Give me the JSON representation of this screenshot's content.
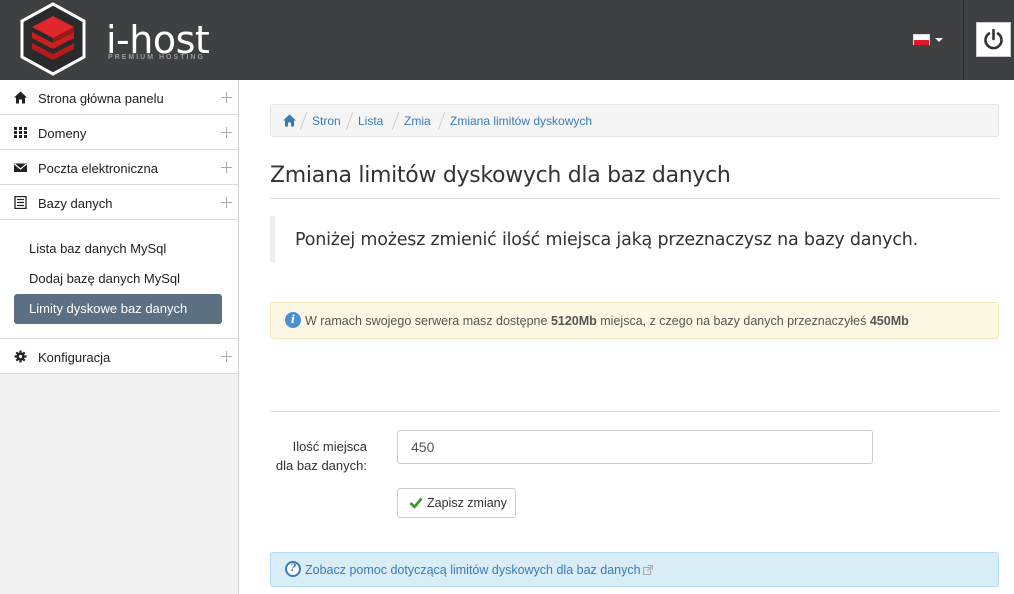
{
  "header": {
    "logo_text": "i-host",
    "logo_subtitle": "PREMIUM HOSTING",
    "language": "pl"
  },
  "sidebar": {
    "items": [
      {
        "label": "Strona główna panelu",
        "icon": "home-icon"
      },
      {
        "label": "Domeny",
        "icon": "grid-icon"
      },
      {
        "label": "Poczta elektroniczna",
        "icon": "envelope-icon"
      },
      {
        "label": "Bazy danych",
        "icon": "list-icon"
      },
      {
        "label": "Konfiguracja",
        "icon": "gear-icon"
      }
    ],
    "submenu": [
      {
        "label": "Lista baz danych MySql",
        "active": false
      },
      {
        "label": "Dodaj bazę danych MySql",
        "active": false
      },
      {
        "label": "Limity dyskowe baz danych",
        "active": true
      }
    ]
  },
  "breadcrumb": [
    "Stron",
    "Lista",
    "Zmia",
    "Zmiana limitów dyskowych"
  ],
  "page": {
    "title": "Zmiana limitów dyskowych dla baz danych",
    "lead": "Poniżej możesz zmienić ilość miejsca jaką przeznaczysz na bazy danych.",
    "alert": {
      "prefix": "W ramach swojego serwera masz dostępne ",
      "available": "5120Mb",
      "middle": " miejsca, z czego na bazy danych przeznaczyłeś ",
      "used": "450Mb"
    },
    "form": {
      "label_line1": "Ilość miejsca",
      "label_line2": "dla baz danych:",
      "value": "450",
      "save_label": "Zapisz zmiany"
    },
    "help_link": "Zobacz pomoc dotyczącą limitów dyskowych dla baz danych"
  },
  "colors": {
    "topbar": "#3f4043",
    "logo_red": "#d8262a",
    "active_menu": "#5b7083",
    "link": "#3a7ab8"
  }
}
